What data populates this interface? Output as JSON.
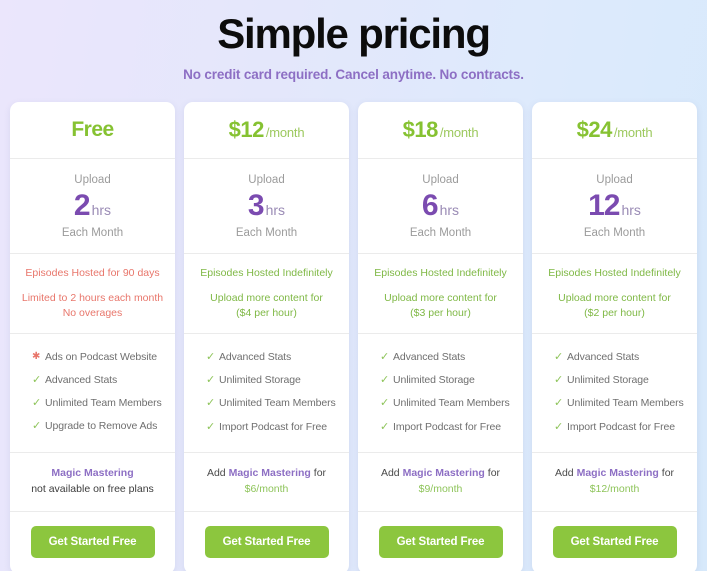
{
  "header": {
    "title": "Simple pricing",
    "subtitle": "No credit card required. Cancel anytime. No contracts."
  },
  "colors": {
    "accent_green": "#86c232",
    "button_green": "#8cc63e",
    "purple": "#7b4bb0",
    "subtitle_purple": "#8d6fc4",
    "warn_red": "#e8766b",
    "gray_text": "#6f6f6f",
    "bg_gradient_from": "#ebe6fc",
    "bg_gradient_to": "#d7e9fb"
  },
  "cta_label": "Get Started Free",
  "plans": [
    {
      "name": "Free",
      "price": "Free",
      "period": "",
      "upload_label": "Upload",
      "upload_amount": "2",
      "upload_unit": "hrs",
      "upload_each": "Each Month",
      "notes": [
        {
          "text": "Episodes Hosted for 90 days",
          "style": "warn"
        },
        {
          "text": "Limited to 2 hours each month\nNo overages",
          "style": "warn"
        }
      ],
      "features": [
        {
          "mark": "asterisk-icon",
          "glyph": "✱",
          "label": "Ads on Podcast Website",
          "style": "star"
        },
        {
          "mark": "check-icon",
          "glyph": "✓",
          "label": "Advanced Stats",
          "style": "check"
        },
        {
          "mark": "check-icon",
          "glyph": "✓",
          "label": "Unlimited Team Members",
          "style": "check"
        },
        {
          "mark": "check-icon",
          "glyph": "✓",
          "label": "Upgrade to Remove Ads",
          "style": "check"
        }
      ],
      "magic": {
        "prefix": "",
        "name": "Magic Mastering",
        "middle": "",
        "price": "",
        "unavailable": "not available on free plans"
      },
      "cta_label": "Get Started Free"
    },
    {
      "name": "$12 plan",
      "price": "$12",
      "period": "/month",
      "upload_label": "Upload",
      "upload_amount": "3",
      "upload_unit": "hrs",
      "upload_each": "Each Month",
      "notes": [
        {
          "text": "Episodes Hosted Indefinitely",
          "style": "green"
        },
        {
          "text": "Upload more content for\n($4 per hour)",
          "style": "green"
        }
      ],
      "features": [
        {
          "mark": "check-icon",
          "glyph": "✓",
          "label": "Advanced Stats",
          "style": "check"
        },
        {
          "mark": "check-icon",
          "glyph": "✓",
          "label": "Unlimited Storage",
          "style": "check"
        },
        {
          "mark": "check-icon",
          "glyph": "✓",
          "label": "Unlimited Team Members",
          "style": "check"
        },
        {
          "mark": "check-icon",
          "glyph": "✓",
          "label": "Import Podcast for Free",
          "style": "check"
        }
      ],
      "magic": {
        "prefix": "Add ",
        "name": "Magic Mastering",
        "middle": " for",
        "price": "$6/month",
        "unavailable": ""
      },
      "cta_label": "Get Started Free"
    },
    {
      "name": "$18 plan",
      "price": "$18",
      "period": "/month",
      "upload_label": "Upload",
      "upload_amount": "6",
      "upload_unit": "hrs",
      "upload_each": "Each Month",
      "notes": [
        {
          "text": "Episodes Hosted Indefinitely",
          "style": "green"
        },
        {
          "text": "Upload more content for\n($3 per hour)",
          "style": "green"
        }
      ],
      "features": [
        {
          "mark": "check-icon",
          "glyph": "✓",
          "label": "Advanced Stats",
          "style": "check"
        },
        {
          "mark": "check-icon",
          "glyph": "✓",
          "label": "Unlimited Storage",
          "style": "check"
        },
        {
          "mark": "check-icon",
          "glyph": "✓",
          "label": "Unlimited Team Members",
          "style": "check"
        },
        {
          "mark": "check-icon",
          "glyph": "✓",
          "label": "Import Podcast for Free",
          "style": "check"
        }
      ],
      "magic": {
        "prefix": "Add ",
        "name": "Magic Mastering",
        "middle": " for",
        "price": "$9/month",
        "unavailable": ""
      },
      "cta_label": "Get Started Free"
    },
    {
      "name": "$24 plan",
      "price": "$24",
      "period": "/month",
      "upload_label": "Upload",
      "upload_amount": "12",
      "upload_unit": "hrs",
      "upload_each": "Each Month",
      "notes": [
        {
          "text": "Episodes Hosted Indefinitely",
          "style": "green"
        },
        {
          "text": "Upload more content for\n($2 per hour)",
          "style": "green"
        }
      ],
      "features": [
        {
          "mark": "check-icon",
          "glyph": "✓",
          "label": "Advanced Stats",
          "style": "check"
        },
        {
          "mark": "check-icon",
          "glyph": "✓",
          "label": "Unlimited Storage",
          "style": "check"
        },
        {
          "mark": "check-icon",
          "glyph": "✓",
          "label": "Unlimited Team Members",
          "style": "check"
        },
        {
          "mark": "check-icon",
          "glyph": "✓",
          "label": "Import Podcast for Free",
          "style": "check"
        }
      ],
      "magic": {
        "prefix": "Add ",
        "name": "Magic Mastering",
        "middle": " for",
        "price": "$12/month",
        "unavailable": ""
      },
      "cta_label": "Get Started Free"
    }
  ]
}
